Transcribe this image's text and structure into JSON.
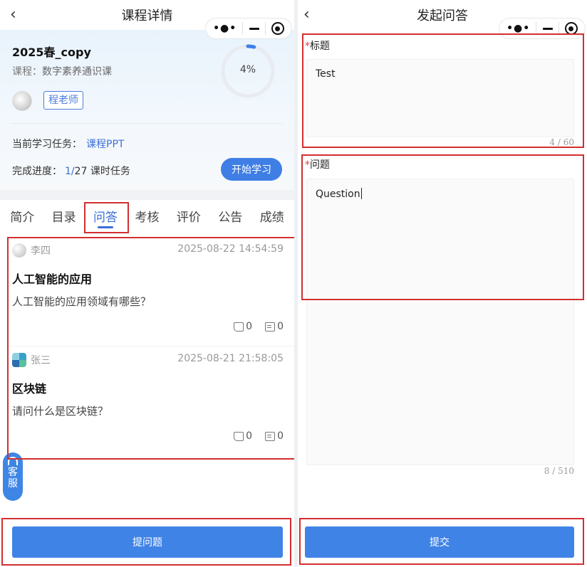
{
  "left": {
    "header": {
      "title": "课程详情",
      "back_icon": "chevron-left-icon"
    },
    "course": {
      "title": "2025春_copy",
      "course_label": "课程：",
      "course_name": "数字素养通识课",
      "teacher": "程老师",
      "progress_percent": "4%",
      "progress_value": 4,
      "task_label": "当前学习任务：",
      "task_name": "课程PPT",
      "progress_label": "完成进度：",
      "progress_done": "1/",
      "progress_total": "27 课时任务",
      "start_label": "开始学习"
    },
    "tabs": [
      {
        "label": "简介"
      },
      {
        "label": "目录"
      },
      {
        "label": "问答",
        "active": true
      },
      {
        "label": "考核"
      },
      {
        "label": "评价"
      },
      {
        "label": "公告"
      },
      {
        "label": "成绩"
      }
    ],
    "qa": [
      {
        "user": "李四",
        "time": "2025-08-22 14:54:59",
        "title": "人工智能的应用",
        "body": "人工智能的应用领域有哪些？",
        "likes": "0",
        "comments": "0"
      },
      {
        "user": "张三",
        "time": "2025-08-21 21:58:05",
        "title": "区块链",
        "body": "请问什么是区块链？",
        "likes": "0",
        "comments": "0"
      }
    ],
    "customer_service": {
      "line1": "客",
      "line2": "服"
    },
    "ask_button": "提问题"
  },
  "right": {
    "header": {
      "title": "发起问答",
      "back_icon": "chevron-left-icon"
    },
    "title_field": {
      "required_mark": "*",
      "label": "标题",
      "value": "Test",
      "counter": "4 / 60"
    },
    "question_field": {
      "required_mark": "*",
      "label": "问题",
      "value": "Question",
      "counter": "8 / 510"
    },
    "submit_button": "提交"
  },
  "colors": {
    "accent": "#3f7ee5",
    "highlight": "#d32f2f",
    "required": "#e53935"
  }
}
